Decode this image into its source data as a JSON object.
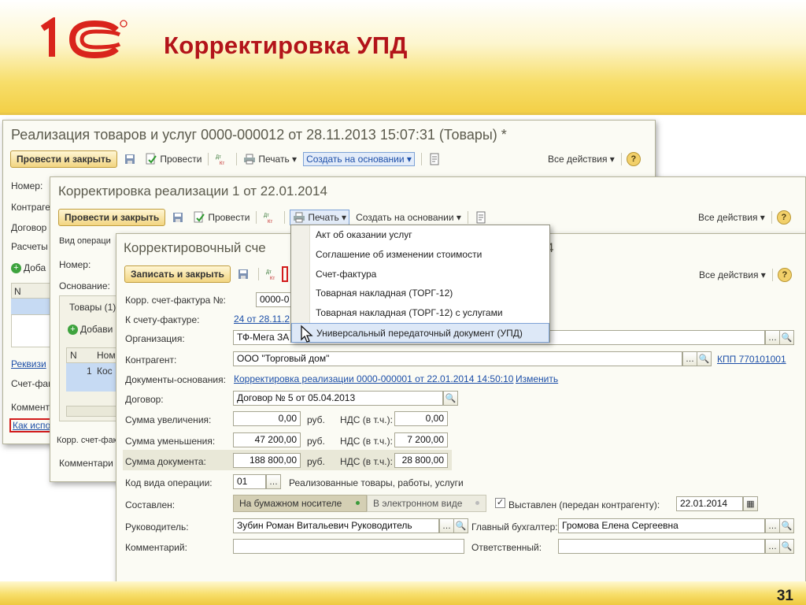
{
  "slide": {
    "title": "Корректировка УПД",
    "page_number": "31",
    "logo_text": "1С"
  },
  "win1": {
    "title": "Реализация товаров и услуг 0000-000012 от 28.11.2013 15:07:31 (Товары) *",
    "post_close": "Провести и закрыть",
    "post": "Провести",
    "print": "Печать",
    "create_based": "Создать на основании",
    "all_actions": "Все действия",
    "labels": [
      "Номер:",
      "Контраге",
      "Договор",
      "Расчеты",
      "Доба",
      "N",
      "Реквизи",
      "Счет-фак",
      "Коммент",
      "Как испо"
    ]
  },
  "win2": {
    "title": "Корректировка реализации 1 от 22.01.2014",
    "post_close": "Провести и закрыть",
    "post": "Провести",
    "print": "Печать",
    "create_based": "Создать на основании",
    "all_actions": "Все действия",
    "vid_oper": "Вид операци",
    "nomer": "Номер:",
    "osnovanie": "Основание:",
    "tab_tovary": "Товары (1)",
    "add": "Добави",
    "col_n": "N",
    "col_nom": "Ном",
    "row_n": "1",
    "row_nom": "Кос",
    "korr_sf": "Корр. счет-фактура",
    "comment": "Комментари"
  },
  "win3": {
    "title": "Корректировочный сче",
    "title_tail": "4",
    "write_close": "Записать и закрыть",
    "all_actions": "Все действия",
    "rows": {
      "korr_sf_label": "Корр. счет-фактура №:",
      "korr_sf_value": "0000-0",
      "k_sf_label": "К счету-фактуре:",
      "k_sf_link": "24 от 28.11.2",
      "org_label": "Организация:",
      "org_value": "ТФ-Мега ЗА",
      "kontr_label": "Контрагент:",
      "kontr_value": "ООО \"Торговый дом\"",
      "kpp_link": "КПП 770101001",
      "docs_label": "Документы-основания:",
      "docs_link": "Корректировка реализации 0000-000001 от 22.01.2014 14:50:10",
      "change_link": "Изменить",
      "dogovor_label": "Договор:",
      "dogovor_value": "Договор № 5 от 05.04.2013",
      "uvel_label": "Сумма увеличения:",
      "uvel_value": "0,00",
      "umen_label": "Сумма уменьшения:",
      "umen_value": "47 200,00",
      "doc_label": "Сумма документа:",
      "doc_value": "188 800,00",
      "rub": "руб.",
      "nds_label": "НДС (в т.ч.):",
      "nds_uvel": "0,00",
      "nds_umen": "7 200,00",
      "nds_doc": "28 800,00",
      "kod_label": "Код вида операции:",
      "kod_value": "01",
      "kod_desc": "Реализованные товары, работы, услуги",
      "sostavlen_label": "Составлен:",
      "paper": "На бумажном носителе",
      "electronic": "В электронном виде",
      "vystavlen": "Выставлен (передан контрагенту):",
      "vystavlen_date": "22.01.2014",
      "ruk_label": "Руководитель:",
      "ruk_value": "Зубин Роман Витальевич Руководитель",
      "glbuh_label": "Главный бухгалтер:",
      "glbuh_value": "Громова Елена Сергеевна",
      "comment_label": "Комментарий:",
      "otv_label": "Ответственный:"
    }
  },
  "print_menu": {
    "items": [
      "Акт об оказании услуг",
      "Соглашение об изменении стоимости",
      "Счет-фактура",
      "Товарная накладная (ТОРГ-12)",
      "Товарная накладная (ТОРГ-12) с услугами",
      "Универсальный передаточный документ (УПД)"
    ],
    "selected_index": 5
  },
  "colors": {
    "accent_red": "#b3141a",
    "link": "#1d4fa8",
    "button_gold": "#f2d581",
    "menu_selected": "#dde8f7"
  }
}
